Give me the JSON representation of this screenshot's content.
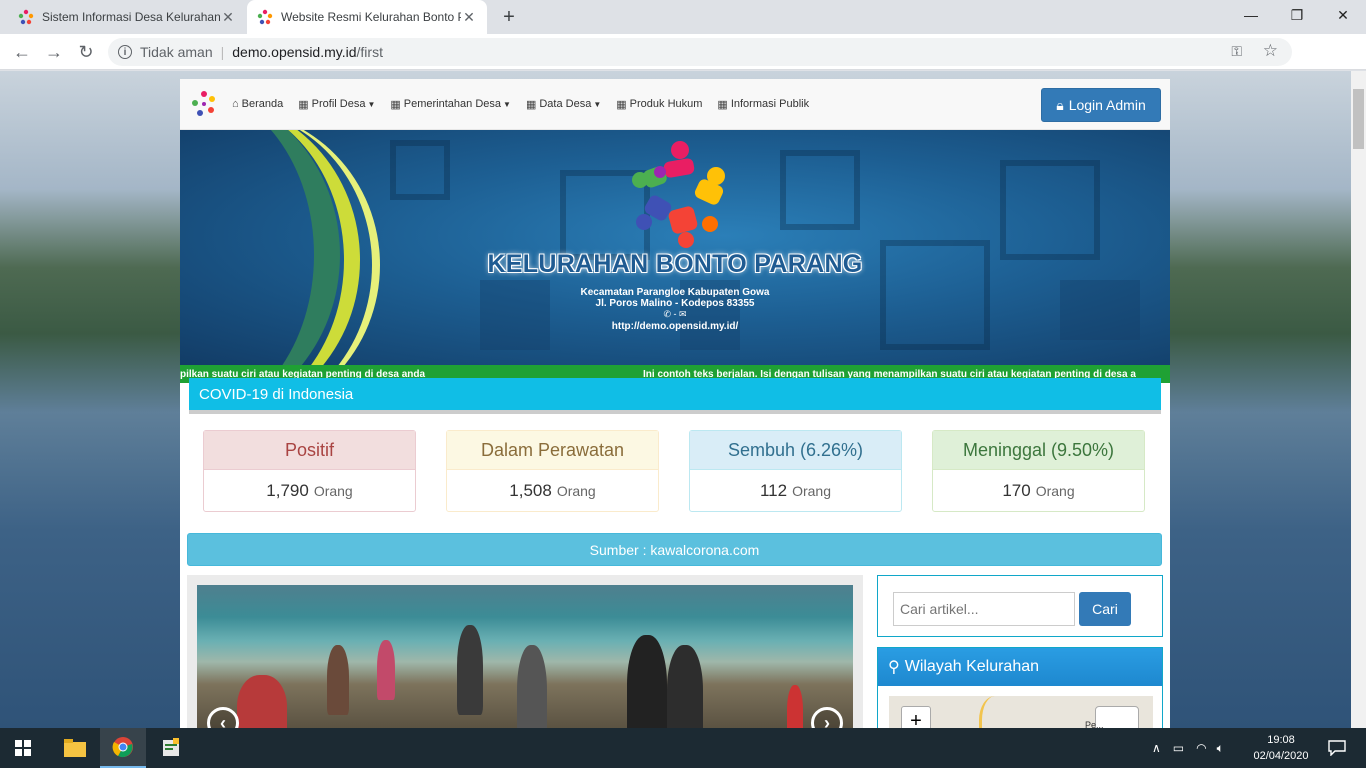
{
  "browser": {
    "tabs": [
      {
        "title": "Sistem Informasi Desa Kelurahan",
        "active": false
      },
      {
        "title": "Website Resmi Kelurahan Bonto Parang",
        "active": true
      }
    ],
    "new_tab": "+",
    "controls": {
      "minimize": "—",
      "restore": "❐",
      "close": "✕"
    },
    "address": {
      "security": "Tidak aman",
      "host": "demo.opensid.my.id",
      "path": "/first"
    }
  },
  "navbar": {
    "items": [
      {
        "label": "Beranda",
        "icon": "home-icon",
        "dropdown": false
      },
      {
        "label": "Profil Desa",
        "icon": "th-icon",
        "dropdown": true
      },
      {
        "label": "Pemerintahan Desa",
        "icon": "th-icon",
        "dropdown": true
      },
      {
        "label": "Data Desa",
        "icon": "th-icon",
        "dropdown": true
      },
      {
        "label": "Produk Hukum",
        "icon": "th-icon",
        "dropdown": false
      },
      {
        "label": "Informasi Publik",
        "icon": "th-icon",
        "dropdown": false
      }
    ],
    "login": "Login Admin"
  },
  "header": {
    "title": "KELURAHAN BONTO PARANG",
    "line1": "Kecamatan Parangloe Kabupaten Gowa",
    "line2": "Jl. Poros Malino - Kodepos 83355",
    "icons": "✆ - ✉",
    "website": "http://demo.opensid.my.id/"
  },
  "ticker": {
    "left": "pilkan suatu ciri atau kegiatan penting di desa anda",
    "right": "Ini contoh teks berjalan. Isi dengan tulisan yang menampilkan suatu ciri atau kegiatan penting di desa a"
  },
  "covid": {
    "title": "COVID-19 di Indonesia",
    "unit": "Orang",
    "cards": [
      {
        "label": "Positif",
        "value": "1,790",
        "color": "#f2dede",
        "border": "#ebccd1",
        "text": "#a94442"
      },
      {
        "label": "Dalam Perawatan",
        "value": "1,508",
        "color": "#fcf8e3",
        "border": "#faebcc",
        "text": "#8a6d3b"
      },
      {
        "label": "Sembuh (6.26%)",
        "value": "112",
        "color": "#d9edf7",
        "border": "#bce8f1",
        "text": "#31708f"
      },
      {
        "label": "Meninggal (9.50%)",
        "value": "170",
        "color": "#dff0d8",
        "border": "#d6e9c6",
        "text": "#3c763d"
      }
    ],
    "source": "Sumber : kawalcorona.com"
  },
  "sidebar": {
    "search_placeholder": "Cari artikel...",
    "search_button": "Cari",
    "wilayah_title": "Wilayah Kelurahan",
    "map_zoom": "+",
    "map_label": "Pe..."
  },
  "taskbar": {
    "time": "19:08",
    "date": "02/04/2020"
  },
  "colors": {
    "primary": "#337ab7",
    "covid_header": "#10bee6",
    "source_bar": "#5bc0de",
    "ticker": "#1fa134"
  }
}
